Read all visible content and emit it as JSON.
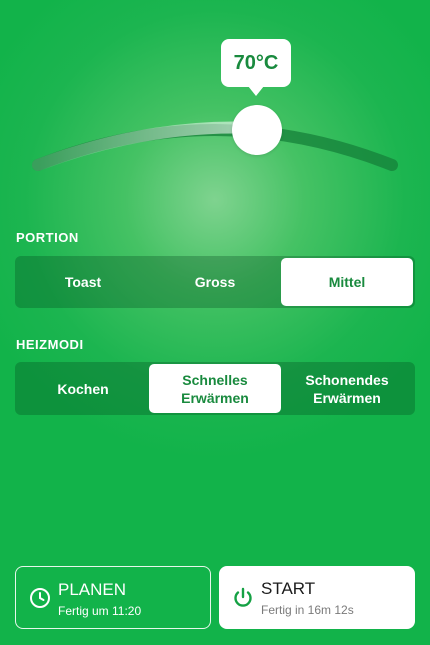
{
  "temperature": {
    "display": "70°C",
    "level": 0.6
  },
  "portion": {
    "label": "PORTION",
    "options": [
      "Toast",
      "Gross",
      "Mittel"
    ],
    "selected": "Mittel"
  },
  "heizmodi": {
    "label": "HEIZMODI",
    "options": [
      "Kochen",
      "Schnelles\nErwärmen",
      "Schonendes\nErwärmen"
    ],
    "selected": "Schnelles\nErwärmen"
  },
  "planen": {
    "title": "PLANEN",
    "subtitle": "Fertig um 11:20",
    "icon": "clock-icon"
  },
  "start": {
    "title": "START",
    "subtitle": "Fertig in 16m 12s",
    "icon": "power-icon"
  },
  "colors": {
    "background": "#12b34a",
    "accent_text": "#198a3e",
    "track_active": "#b9e6c4",
    "track_inactive": "#16803a"
  }
}
